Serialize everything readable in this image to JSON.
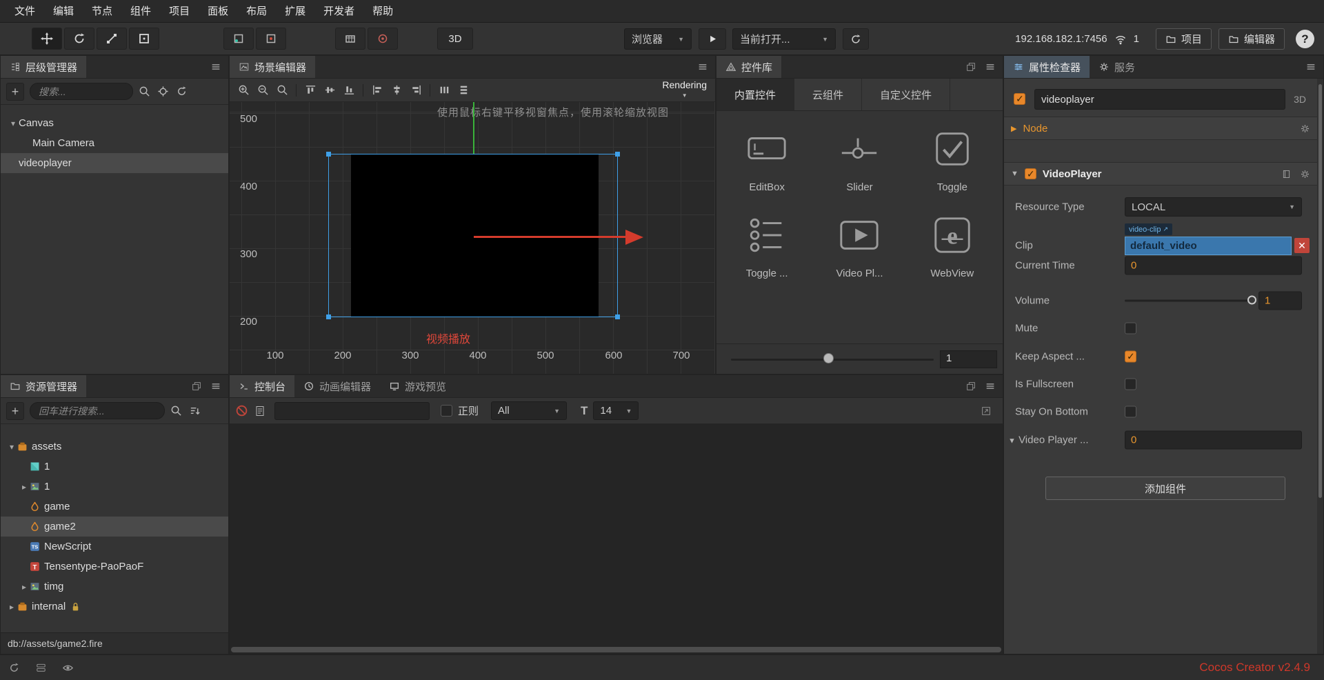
{
  "menubar": {
    "items": [
      "文件",
      "编辑",
      "节点",
      "组件",
      "项目",
      "面板",
      "布局",
      "扩展",
      "开发者",
      "帮助"
    ]
  },
  "toolbar": {
    "tool_icons": [
      "move",
      "rotate",
      "scale",
      "rect"
    ],
    "mode_icons": [
      "pivot",
      "coords"
    ],
    "gizmo_icons": [
      "grid",
      "target"
    ],
    "mode_3d": "3D",
    "preview_target": "浏览器",
    "current_scene": "当前打开...",
    "address": "192.168.182.1:7456",
    "device_count": "1",
    "project": "项目",
    "editor": "编辑器",
    "help": "?"
  },
  "hierarchy": {
    "title": "层级管理器",
    "search_placeholder": "搜索...",
    "toolbar_icons": [
      "search",
      "locate",
      "refresh"
    ],
    "nodes": [
      {
        "label": "Canvas",
        "depth": 0,
        "caret": "down",
        "selected": false
      },
      {
        "label": "Main Camera",
        "depth": 1,
        "caret": "",
        "selected": false
      },
      {
        "label": "videoplayer",
        "depth": 0,
        "caret": "",
        "selected": true
      }
    ]
  },
  "assets": {
    "title": "资源管理器",
    "search_placeholder": "回车进行搜索...",
    "toolbar_icons": [
      "search",
      "sort"
    ],
    "items": [
      {
        "label": "assets",
        "icon": "bundle",
        "depth": 0,
        "caret": "down",
        "selected": false,
        "locked": false
      },
      {
        "label": "1",
        "icon": "texture",
        "depth": 1,
        "caret": "",
        "selected": false,
        "locked": false
      },
      {
        "label": "1",
        "icon": "image",
        "depth": 1,
        "caret": "right",
        "selected": false,
        "locked": false
      },
      {
        "label": "game",
        "icon": "fire",
        "depth": 1,
        "caret": "",
        "selected": false,
        "locked": false
      },
      {
        "label": "game2",
        "icon": "fire",
        "depth": 1,
        "caret": "",
        "selected": true,
        "locked": false
      },
      {
        "label": "NewScript",
        "icon": "typescript",
        "depth": 1,
        "caret": "",
        "selected": false,
        "locked": false
      },
      {
        "label": "Tensentype-PaoPaoF",
        "icon": "font",
        "depth": 1,
        "caret": "",
        "selected": false,
        "locked": false
      },
      {
        "label": "timg",
        "icon": "image",
        "depth": 1,
        "caret": "right",
        "selected": false,
        "locked": false
      },
      {
        "label": "internal",
        "icon": "bundle",
        "depth": 0,
        "caret": "right",
        "selected": false,
        "locked": true
      }
    ],
    "status": "db://assets/game2.fire"
  },
  "scene": {
    "title": "场景编辑器",
    "rendering_label": "Rendering",
    "toolbar_icons": [
      "zoom-in",
      "zoom-out",
      "zoom-reset",
      "sep",
      "align-top",
      "align-middle",
      "align-bottom",
      "sep",
      "align-left",
      "align-center",
      "align-right",
      "sep",
      "distribute-h",
      "distribute-v"
    ],
    "hint": "使用鼠标右键平移视窗焦点，使用滚轮缩放视图",
    "selection_label": "视频播放",
    "x_ticks": [
      "100",
      "200",
      "300",
      "400",
      "500",
      "600",
      "700"
    ],
    "y_ticks": [
      "500",
      "400",
      "300",
      "200"
    ]
  },
  "widget_library": {
    "title": "控件库",
    "tabs": [
      {
        "label": "内置控件",
        "active": true
      },
      {
        "label": "云组件",
        "active": false
      },
      {
        "label": "自定义控件",
        "active": false
      }
    ],
    "widgets": [
      {
        "label": "EditBox",
        "icon": "editbox"
      },
      {
        "label": "Slider",
        "icon": "slider"
      },
      {
        "label": "Toggle",
        "icon": "toggle"
      },
      {
        "label": "Toggle ...",
        "icon": "toggle-group"
      },
      {
        "label": "Video Pl...",
        "icon": "video-player"
      },
      {
        "label": "WebView",
        "icon": "webview"
      }
    ],
    "zoom_value": "1"
  },
  "console": {
    "tabs": [
      {
        "label": "控制台",
        "icon": "console",
        "active": true
      },
      {
        "label": "动画编辑器",
        "icon": "animation",
        "active": false
      },
      {
        "label": "游戏预览",
        "icon": "preview",
        "active": false
      }
    ],
    "toolbar_icons": [
      "clear",
      "log-file"
    ],
    "filter_input_value": "",
    "regex_label": "正则",
    "regex_checked": false,
    "filter_value": "All",
    "font_size_value": "14",
    "right_icon": "export"
  },
  "inspector": {
    "tabs": [
      {
        "label": "属性检查器",
        "icon": "inspector",
        "active": true
      },
      {
        "label": "服务",
        "icon": "services",
        "active": false
      }
    ],
    "node": {
      "name": "videoplayer",
      "enabled": true,
      "mode": "3D"
    },
    "sections": {
      "node_label": "Node",
      "component_label": "VideoPlayer"
    },
    "properties": {
      "resource_type": {
        "label": "Resource Type",
        "value": "LOCAL"
      },
      "clip": {
        "label": "Clip",
        "tag": "video-clip",
        "value": "default_video"
      },
      "current_time": {
        "label": "Current Time",
        "value": "0"
      },
      "volume": {
        "label": "Volume",
        "value": "1"
      },
      "mute": {
        "label": "Mute",
        "checked": false
      },
      "keep_aspect": {
        "label": "Keep Aspect ...",
        "checked": true
      },
      "is_fullscreen": {
        "label": "Is Fullscreen",
        "checked": false
      },
      "stay_on_bottom": {
        "label": "Stay On Bottom",
        "checked": false
      },
      "video_player_event": {
        "label": "Video Player ...",
        "value": "0"
      }
    },
    "add_component_label": "添加组件"
  },
  "statusbar": {
    "icons": [
      "sync",
      "layers",
      "eye"
    ],
    "watermark": "Cocos Creator v2.4.9"
  },
  "colors": {
    "accent_orange": "#e8872a",
    "value_orange": "#e8962e",
    "selection_blue": "#3a77ad",
    "node_select_blue": "#3fa0e8",
    "gizmo_red": "#d43b2c",
    "gizmo_green": "#39b339",
    "watermark_red": "#cf382a"
  }
}
